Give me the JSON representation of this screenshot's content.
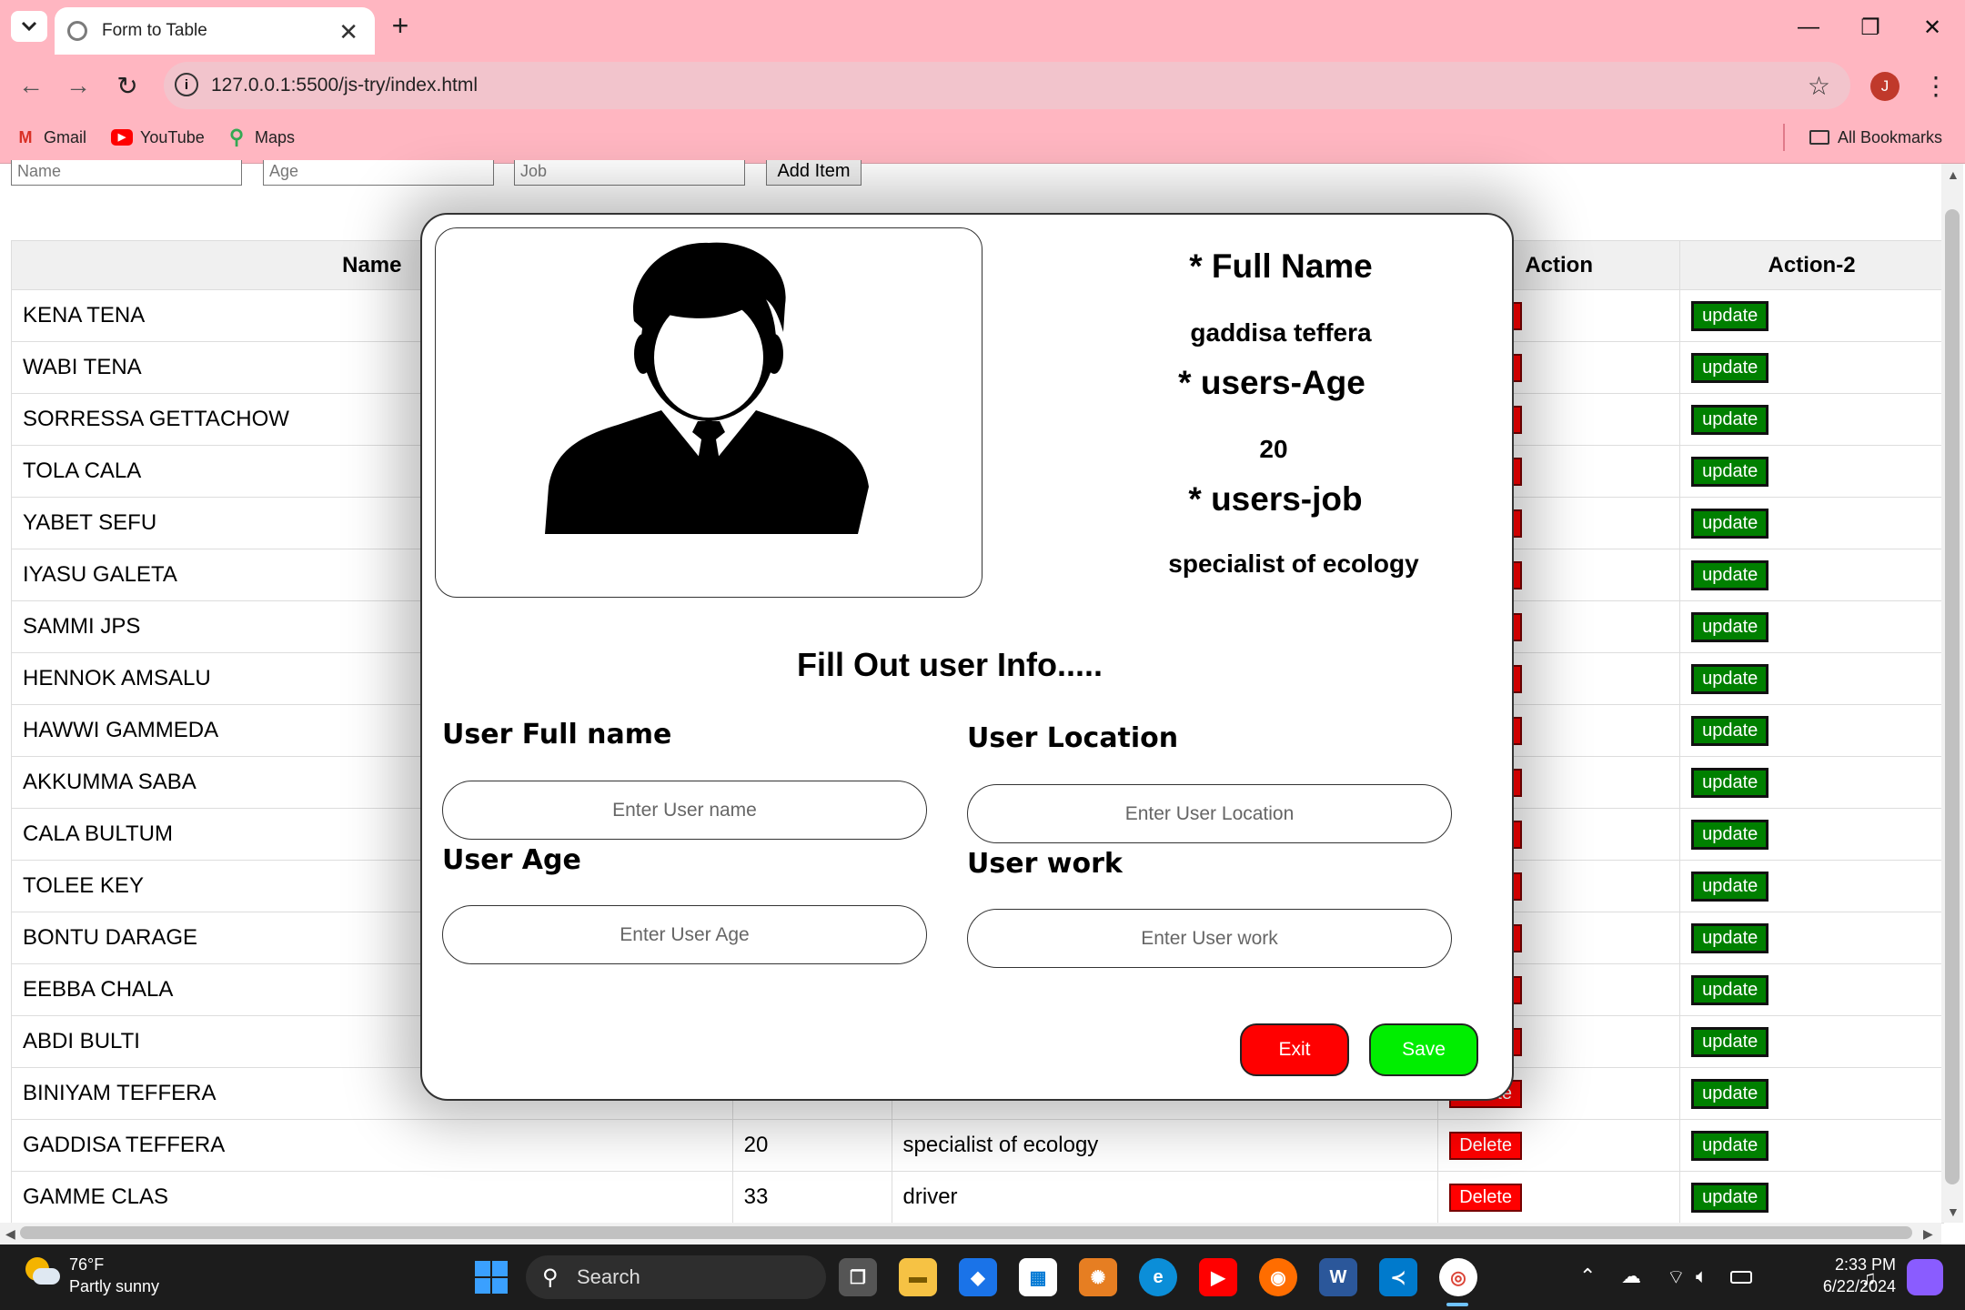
{
  "browser": {
    "tab_title": "Form to Table",
    "url": "127.0.0.1:5500/js-try/index.html",
    "bookmarks": [
      "Gmail",
      "YouTube",
      "Maps"
    ],
    "all_bookmarks": "All Bookmarks",
    "profile_initial": "J"
  },
  "form": {
    "name_placeholder": "Name",
    "age_placeholder": "Age",
    "job_placeholder": "Job",
    "add_button": "Add Item"
  },
  "table": {
    "headers": [
      "Name",
      "",
      "",
      "Action",
      "Action-2"
    ],
    "update_label": "update",
    "delete_label": "Delete",
    "rows": [
      {
        "name": "KENA TENA"
      },
      {
        "name": "WABI TENA"
      },
      {
        "name": "SORRESSA GETTACHOW"
      },
      {
        "name": "TOLA CALA"
      },
      {
        "name": "YABET SEFU"
      },
      {
        "name": "IYASU GALETA"
      },
      {
        "name": "SAMMI JPS"
      },
      {
        "name": "HENNOK AMSALU"
      },
      {
        "name": "HAWWI GAMMEDA"
      },
      {
        "name": "AKKUMMA SABA"
      },
      {
        "name": "CALA BULTUM"
      },
      {
        "name": "TOLEE KEY"
      },
      {
        "name": "BONTU DARAGE"
      },
      {
        "name": "EEBBA CHALA"
      },
      {
        "name": "ABDI BULTI"
      },
      {
        "name": "BINIYAM TEFFERA"
      },
      {
        "name": "GADDISA TEFFERA",
        "age": "20",
        "job": "specialist of ecology"
      },
      {
        "name": "GAMME CLAS",
        "age": "33",
        "job": "driver"
      }
    ]
  },
  "modal": {
    "full_name_heading": "* Full Name",
    "full_name_value": "gaddisa teffera",
    "age_heading": "* users-Age",
    "age_value": "20",
    "job_heading": "* users-job",
    "job_value": "specialist of ecology",
    "form_title": "Fill Out user Info.....",
    "label_full_name": "User Full name",
    "label_location": "User Location",
    "label_age": "User Age",
    "label_work": "User work",
    "ph_name": "Enter User name",
    "ph_location": "Enter User Location",
    "ph_age": "Enter User Age",
    "ph_work": "Enter User work",
    "exit_label": "Exit",
    "save_label": "Save",
    "exit_color": "#ff0000",
    "save_color": "#00ee00"
  },
  "taskbar": {
    "temperature": "76°F",
    "weather": "Partly sunny",
    "search": "Search",
    "time": "2:33 PM",
    "date": "6/22/2024"
  }
}
